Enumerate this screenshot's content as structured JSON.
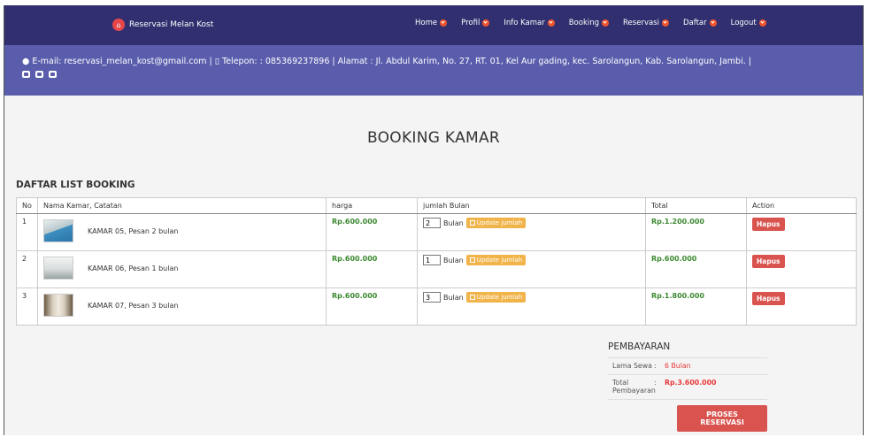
{
  "navbar": {
    "brand": "Reservasi Melan Kost",
    "menu": [
      {
        "label": "Home"
      },
      {
        "label": "Profil"
      },
      {
        "label": "Info Kamar"
      },
      {
        "label": "Booking"
      },
      {
        "label": "Reservasi"
      },
      {
        "label": "Daftar"
      },
      {
        "label": "Logout"
      }
    ]
  },
  "infobar": {
    "text": "E-mail: reservasi_melan_kost@gmail.com | ▯ Telepon: : 085369237896 | Alamat : Jl. Abdul Karim, No. 27, RT. 01, Kel Aur gading, kec. Sarolangun, Kab. Sarolangun, Jambi. |"
  },
  "page": {
    "title": "BOOKING KAMAR",
    "list_title": "DAFTAR LIST BOOKING"
  },
  "table": {
    "headers": [
      "No",
      "Nama Kamar, Catatan",
      "harga",
      "jumlah Bulan",
      "Total",
      "Action"
    ],
    "rows": [
      {
        "no": "1",
        "name": "KAMAR 05, Pesan 2 bulan",
        "harga": "Rp.600.000",
        "qty": "2",
        "unit": "Bulan",
        "update": "Update jumlah",
        "total": "Rp.1.200.000",
        "action": "Hapus"
      },
      {
        "no": "2",
        "name": "KAMAR 06, Pesan 1 bulan",
        "harga": "Rp.600.000",
        "qty": "1",
        "unit": "Bulan",
        "update": "Update jumlah",
        "total": "Rp.600.000",
        "action": "Hapus"
      },
      {
        "no": "3",
        "name": "KAMAR 07, Pesan 3 bulan",
        "harga": "Rp.600.000",
        "qty": "3",
        "unit": "Bulan",
        "update": "Update jumlah",
        "total": "Rp.1.800.000",
        "action": "Hapus"
      }
    ]
  },
  "summary": {
    "title": "PEMBAYARAN",
    "lama_label": "Lama Sewa",
    "lama_value": "6 Bulan",
    "total_label": "Total Pembayaran",
    "total_value": "Rp.3.600.000",
    "button": "PROSES RESERVASI",
    "colon": ":"
  },
  "colors": {
    "navbar": "#312f6f",
    "infobar": "#5a5dac",
    "price_green": "#3d8a32",
    "danger": "#d9534f",
    "warning": "#f1b44a"
  }
}
